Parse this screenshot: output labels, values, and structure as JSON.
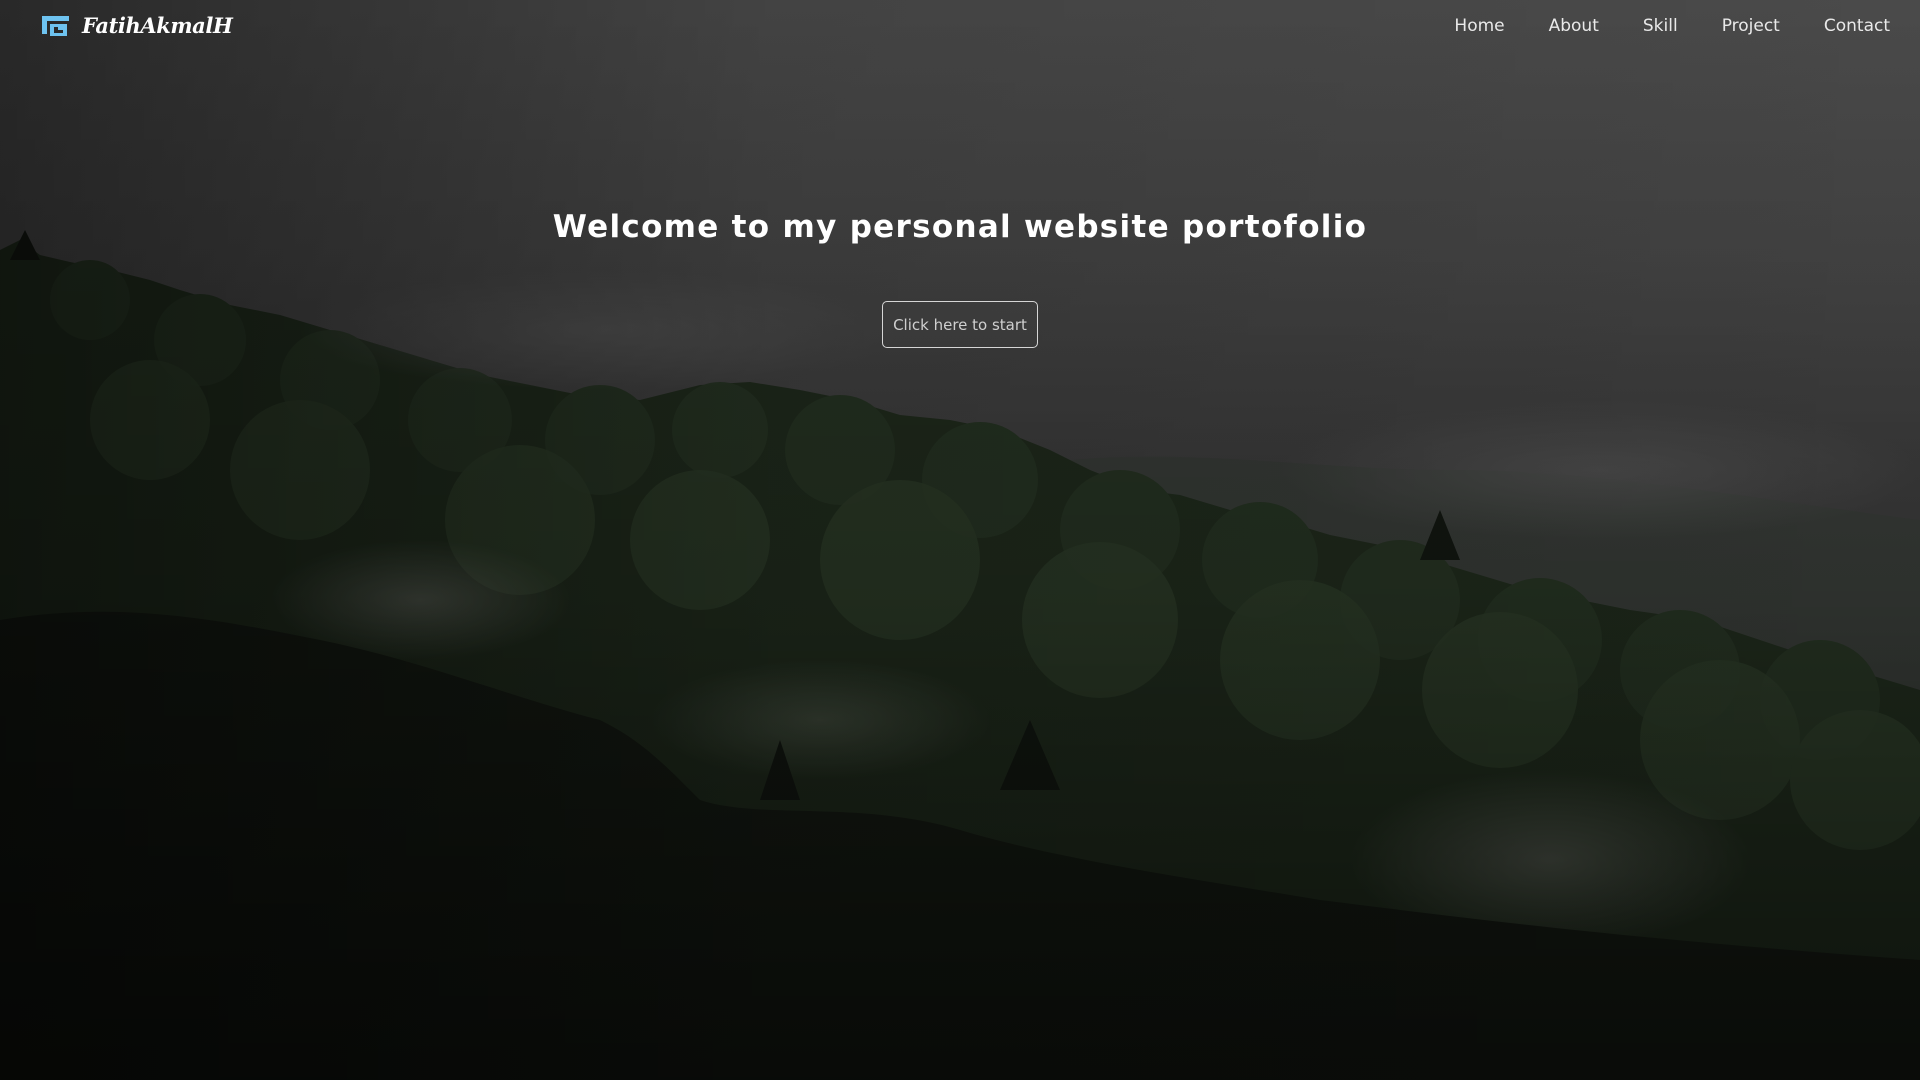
{
  "brand": {
    "name": "FatihAkmalH",
    "logo_icon": "stylized-f-logo-icon",
    "accent_color": "#6ec3f0"
  },
  "nav": {
    "items": [
      {
        "label": "Home"
      },
      {
        "label": "About"
      },
      {
        "label": "Skill"
      },
      {
        "label": "Project"
      },
      {
        "label": "Contact"
      }
    ]
  },
  "hero": {
    "title": "Welcome to my personal website portofolio",
    "button_label": "Click here to start",
    "background": "misty forested hills under overcast sky, darkened overlay"
  }
}
